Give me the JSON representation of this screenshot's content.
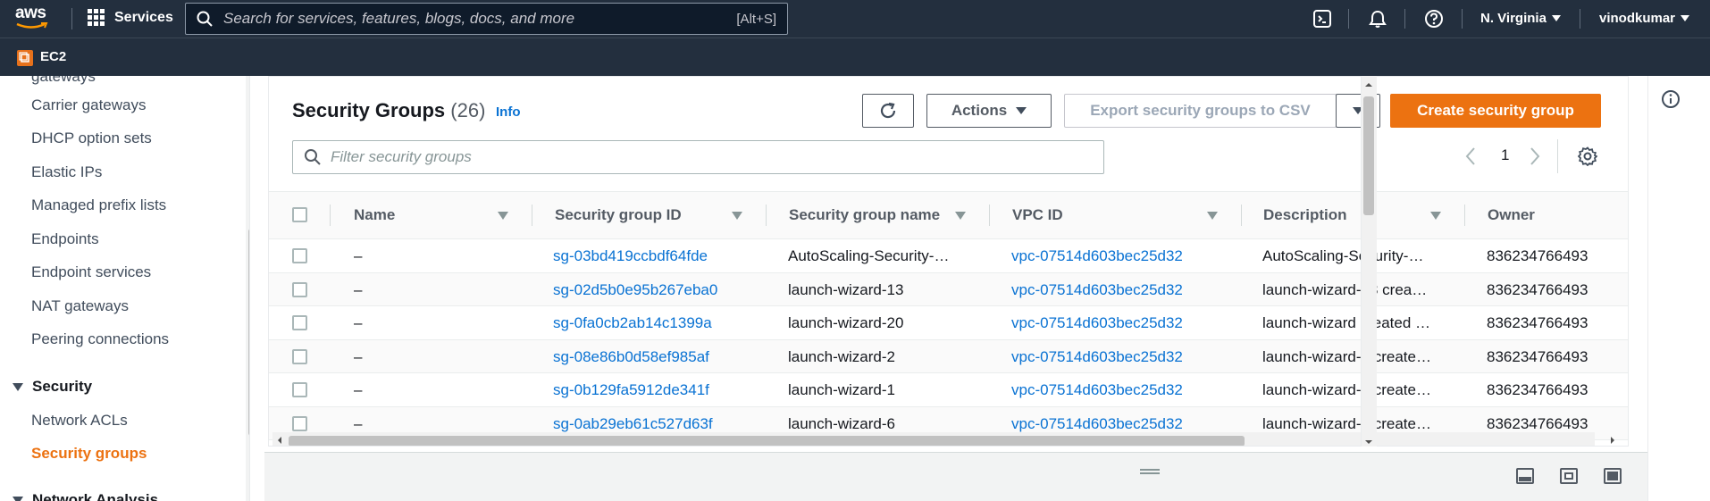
{
  "topnav": {
    "logo_text": "aws",
    "services_label": "Services",
    "search_placeholder": "Search for services, features, blogs, docs, and more",
    "search_shortcut": "[Alt+S]",
    "region": "N. Virginia",
    "user": "vinodkumar"
  },
  "subnav": {
    "service_label": "EC2"
  },
  "sidebar": {
    "items": [
      {
        "label": "gateways"
      },
      {
        "label": "Carrier gateways"
      },
      {
        "label": "DHCP option sets"
      },
      {
        "label": "Elastic IPs"
      },
      {
        "label": "Managed prefix lists"
      },
      {
        "label": "Endpoints"
      },
      {
        "label": "Endpoint services"
      },
      {
        "label": "NAT gateways"
      },
      {
        "label": "Peering connections"
      }
    ],
    "section_security": "Security",
    "security_items": [
      {
        "label": "Network ACLs"
      },
      {
        "label": "Security groups"
      }
    ],
    "section_next": "Network Analysis",
    "active_color": "#ec7211"
  },
  "main": {
    "title": "Security Groups",
    "count": "(26)",
    "info_label": "Info",
    "actions_label": "Actions",
    "export_label": "Export security groups to CSV",
    "create_label": "Create security group",
    "filter_placeholder": "Filter security groups",
    "page_number": "1",
    "columns": [
      "Name",
      "Security group ID",
      "Security group name",
      "VPC ID",
      "Description",
      "Owner"
    ],
    "rows": [
      {
        "name": "–",
        "sg_id": "sg-03bd419ccbdf64fde",
        "sg_name": "AutoScaling-Security-…",
        "vpc": "vpc-07514d603bec25d32",
        "desc": "AutoScaling-Security-…",
        "owner": "836234766493"
      },
      {
        "name": "–",
        "sg_id": "sg-02d5b0e95b267eba0",
        "sg_name": "launch-wizard-13",
        "vpc": "vpc-07514d603bec25d32",
        "desc": "launch-wizard-13 crea…",
        "owner": "836234766493"
      },
      {
        "name": "–",
        "sg_id": "sg-0fa0cb2ab14c1399a",
        "sg_name": "launch-wizard-20",
        "vpc": "vpc-07514d603bec25d32",
        "desc": "launch-wizard created …",
        "owner": "836234766493"
      },
      {
        "name": "–",
        "sg_id": "sg-08e86b0d58ef985af",
        "sg_name": "launch-wizard-2",
        "vpc": "vpc-07514d603bec25d32",
        "desc": "launch-wizard-2 create…",
        "owner": "836234766493"
      },
      {
        "name": "–",
        "sg_id": "sg-0b129fa5912de341f",
        "sg_name": "launch-wizard-1",
        "vpc": "vpc-07514d603bec25d32",
        "desc": "launch-wizard-1 create…",
        "owner": "836234766493"
      },
      {
        "name": "–",
        "sg_id": "sg-0ab29eb61c527d63f",
        "sg_name": "launch-wizard-6",
        "vpc": "vpc-07514d603bec25d32",
        "desc": "launch-wizard-6 create…",
        "owner": "836234766493"
      }
    ],
    "link_color": "#0972d3",
    "primary_color": "#ec7211"
  },
  "icons": {
    "cloudshell": "cloudshell-icon",
    "notifications": "bell-icon",
    "help": "help-icon",
    "refresh": "refresh-icon",
    "settings": "gear-icon",
    "info": "info-icon"
  }
}
